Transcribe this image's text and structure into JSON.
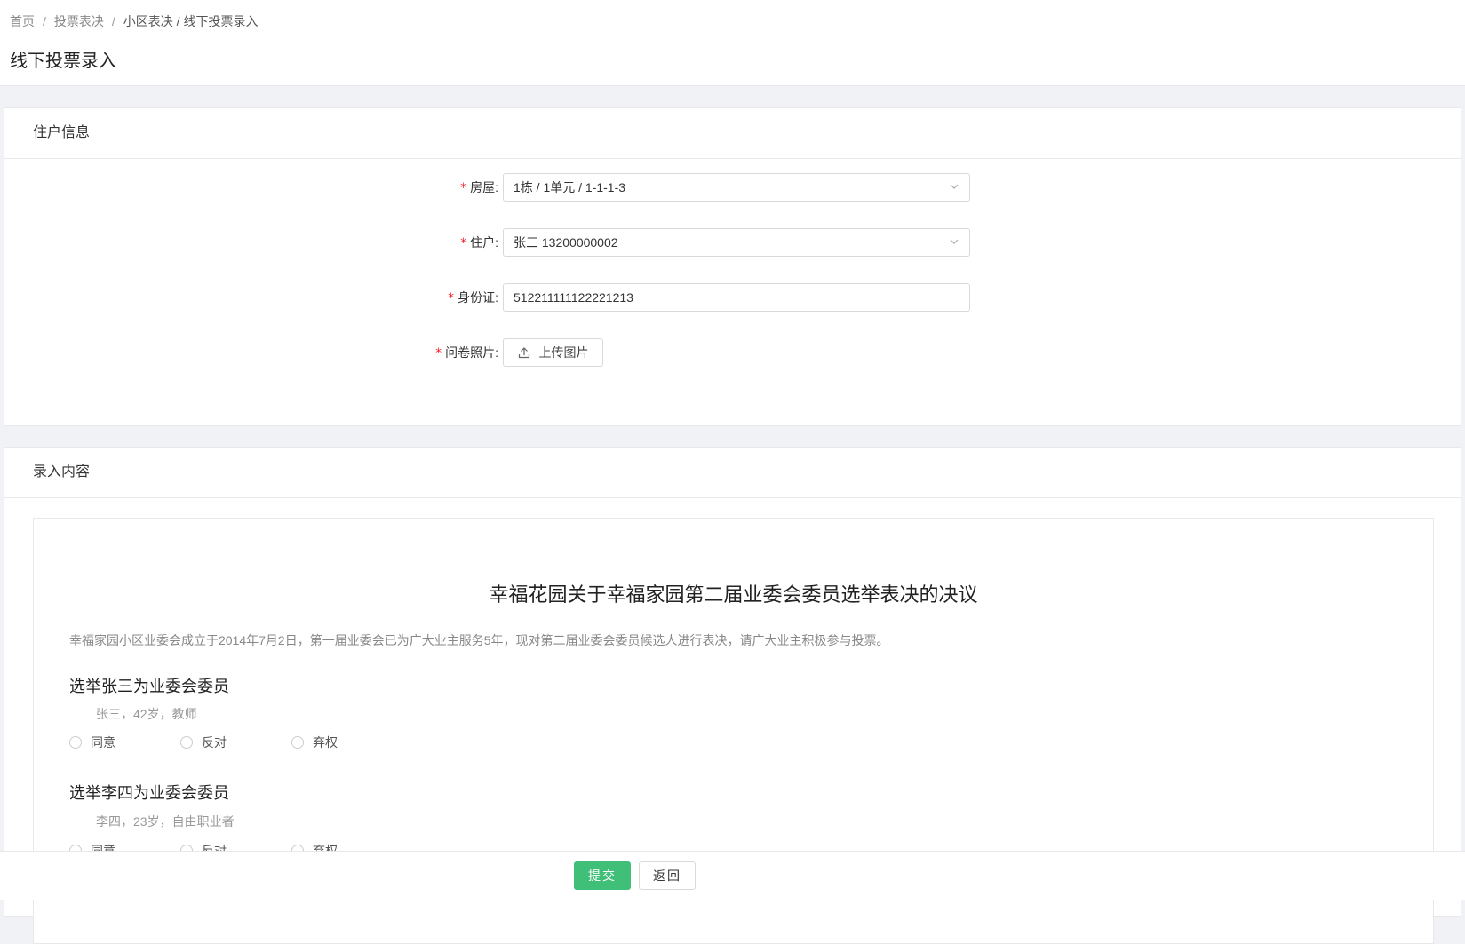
{
  "breadcrumb": {
    "items": [
      "首页",
      "投票表决",
      "小区表决 / 线下投票录入"
    ]
  },
  "page_title": "线下投票录入",
  "resident_card": {
    "title": "住户信息",
    "fields": {
      "house": {
        "label": "房屋:",
        "value": "1栋 / 1单元 / 1-1-1-3"
      },
      "resident": {
        "label": "住户:",
        "value": "张三 13200000002"
      },
      "id_card": {
        "label": "身份证:",
        "value": "512211111122221213"
      },
      "photo": {
        "label": "问卷照片:",
        "button": "上传图片"
      }
    },
    "required_mark": "*"
  },
  "content_card": {
    "title": "录入内容",
    "survey": {
      "title": "幸福花园关于幸福家园第二届业委会委员选举表决的决议",
      "description": "幸福家园小区业委会成立于2014年7月2日，第一届业委会已为广大业主服务5年，现对第二届业委会委员候选人进行表决，请广大业主积极参与投票。",
      "questions": [
        {
          "title": "选举张三为业委会委员",
          "subtitle": "张三，42岁，教师",
          "options": [
            "同意",
            "反对",
            "弃权"
          ]
        },
        {
          "title": "选举李四为业委会委员",
          "subtitle": "李四，23岁，自由职业者",
          "options": [
            "同意",
            "反对",
            "弃权"
          ]
        }
      ]
    }
  },
  "footer": {
    "submit": "提交",
    "back": "返回"
  },
  "colors": {
    "primary": "#3fbf78",
    "required": "#f5222d"
  }
}
